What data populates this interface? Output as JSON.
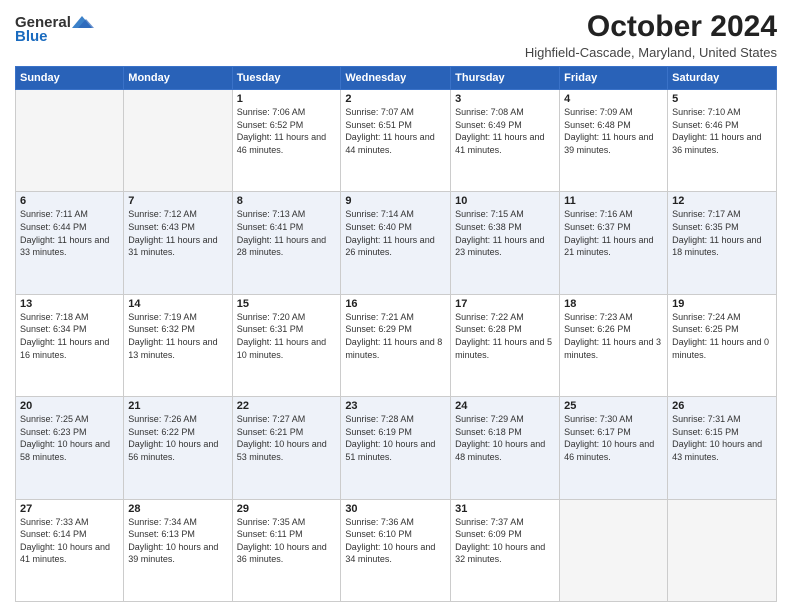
{
  "header": {
    "logo_general": "General",
    "logo_blue": "Blue",
    "month_title": "October 2024",
    "location": "Highfield-Cascade, Maryland, United States"
  },
  "days_of_week": [
    "Sunday",
    "Monday",
    "Tuesday",
    "Wednesday",
    "Thursday",
    "Friday",
    "Saturday"
  ],
  "weeks": [
    [
      {
        "day": "",
        "sunrise": "",
        "sunset": "",
        "daylight": ""
      },
      {
        "day": "",
        "sunrise": "",
        "sunset": "",
        "daylight": ""
      },
      {
        "day": "1",
        "sunrise": "Sunrise: 7:06 AM",
        "sunset": "Sunset: 6:52 PM",
        "daylight": "Daylight: 11 hours and 46 minutes."
      },
      {
        "day": "2",
        "sunrise": "Sunrise: 7:07 AM",
        "sunset": "Sunset: 6:51 PM",
        "daylight": "Daylight: 11 hours and 44 minutes."
      },
      {
        "day": "3",
        "sunrise": "Sunrise: 7:08 AM",
        "sunset": "Sunset: 6:49 PM",
        "daylight": "Daylight: 11 hours and 41 minutes."
      },
      {
        "day": "4",
        "sunrise": "Sunrise: 7:09 AM",
        "sunset": "Sunset: 6:48 PM",
        "daylight": "Daylight: 11 hours and 39 minutes."
      },
      {
        "day": "5",
        "sunrise": "Sunrise: 7:10 AM",
        "sunset": "Sunset: 6:46 PM",
        "daylight": "Daylight: 11 hours and 36 minutes."
      }
    ],
    [
      {
        "day": "6",
        "sunrise": "Sunrise: 7:11 AM",
        "sunset": "Sunset: 6:44 PM",
        "daylight": "Daylight: 11 hours and 33 minutes."
      },
      {
        "day": "7",
        "sunrise": "Sunrise: 7:12 AM",
        "sunset": "Sunset: 6:43 PM",
        "daylight": "Daylight: 11 hours and 31 minutes."
      },
      {
        "day": "8",
        "sunrise": "Sunrise: 7:13 AM",
        "sunset": "Sunset: 6:41 PM",
        "daylight": "Daylight: 11 hours and 28 minutes."
      },
      {
        "day": "9",
        "sunrise": "Sunrise: 7:14 AM",
        "sunset": "Sunset: 6:40 PM",
        "daylight": "Daylight: 11 hours and 26 minutes."
      },
      {
        "day": "10",
        "sunrise": "Sunrise: 7:15 AM",
        "sunset": "Sunset: 6:38 PM",
        "daylight": "Daylight: 11 hours and 23 minutes."
      },
      {
        "day": "11",
        "sunrise": "Sunrise: 7:16 AM",
        "sunset": "Sunset: 6:37 PM",
        "daylight": "Daylight: 11 hours and 21 minutes."
      },
      {
        "day": "12",
        "sunrise": "Sunrise: 7:17 AM",
        "sunset": "Sunset: 6:35 PM",
        "daylight": "Daylight: 11 hours and 18 minutes."
      }
    ],
    [
      {
        "day": "13",
        "sunrise": "Sunrise: 7:18 AM",
        "sunset": "Sunset: 6:34 PM",
        "daylight": "Daylight: 11 hours and 16 minutes."
      },
      {
        "day": "14",
        "sunrise": "Sunrise: 7:19 AM",
        "sunset": "Sunset: 6:32 PM",
        "daylight": "Daylight: 11 hours and 13 minutes."
      },
      {
        "day": "15",
        "sunrise": "Sunrise: 7:20 AM",
        "sunset": "Sunset: 6:31 PM",
        "daylight": "Daylight: 11 hours and 10 minutes."
      },
      {
        "day": "16",
        "sunrise": "Sunrise: 7:21 AM",
        "sunset": "Sunset: 6:29 PM",
        "daylight": "Daylight: 11 hours and 8 minutes."
      },
      {
        "day": "17",
        "sunrise": "Sunrise: 7:22 AM",
        "sunset": "Sunset: 6:28 PM",
        "daylight": "Daylight: 11 hours and 5 minutes."
      },
      {
        "day": "18",
        "sunrise": "Sunrise: 7:23 AM",
        "sunset": "Sunset: 6:26 PM",
        "daylight": "Daylight: 11 hours and 3 minutes."
      },
      {
        "day": "19",
        "sunrise": "Sunrise: 7:24 AM",
        "sunset": "Sunset: 6:25 PM",
        "daylight": "Daylight: 11 hours and 0 minutes."
      }
    ],
    [
      {
        "day": "20",
        "sunrise": "Sunrise: 7:25 AM",
        "sunset": "Sunset: 6:23 PM",
        "daylight": "Daylight: 10 hours and 58 minutes."
      },
      {
        "day": "21",
        "sunrise": "Sunrise: 7:26 AM",
        "sunset": "Sunset: 6:22 PM",
        "daylight": "Daylight: 10 hours and 56 minutes."
      },
      {
        "day": "22",
        "sunrise": "Sunrise: 7:27 AM",
        "sunset": "Sunset: 6:21 PM",
        "daylight": "Daylight: 10 hours and 53 minutes."
      },
      {
        "day": "23",
        "sunrise": "Sunrise: 7:28 AM",
        "sunset": "Sunset: 6:19 PM",
        "daylight": "Daylight: 10 hours and 51 minutes."
      },
      {
        "day": "24",
        "sunrise": "Sunrise: 7:29 AM",
        "sunset": "Sunset: 6:18 PM",
        "daylight": "Daylight: 10 hours and 48 minutes."
      },
      {
        "day": "25",
        "sunrise": "Sunrise: 7:30 AM",
        "sunset": "Sunset: 6:17 PM",
        "daylight": "Daylight: 10 hours and 46 minutes."
      },
      {
        "day": "26",
        "sunrise": "Sunrise: 7:31 AM",
        "sunset": "Sunset: 6:15 PM",
        "daylight": "Daylight: 10 hours and 43 minutes."
      }
    ],
    [
      {
        "day": "27",
        "sunrise": "Sunrise: 7:33 AM",
        "sunset": "Sunset: 6:14 PM",
        "daylight": "Daylight: 10 hours and 41 minutes."
      },
      {
        "day": "28",
        "sunrise": "Sunrise: 7:34 AM",
        "sunset": "Sunset: 6:13 PM",
        "daylight": "Daylight: 10 hours and 39 minutes."
      },
      {
        "day": "29",
        "sunrise": "Sunrise: 7:35 AM",
        "sunset": "Sunset: 6:11 PM",
        "daylight": "Daylight: 10 hours and 36 minutes."
      },
      {
        "day": "30",
        "sunrise": "Sunrise: 7:36 AM",
        "sunset": "Sunset: 6:10 PM",
        "daylight": "Daylight: 10 hours and 34 minutes."
      },
      {
        "day": "31",
        "sunrise": "Sunrise: 7:37 AM",
        "sunset": "Sunset: 6:09 PM",
        "daylight": "Daylight: 10 hours and 32 minutes."
      },
      {
        "day": "",
        "sunrise": "",
        "sunset": "",
        "daylight": ""
      },
      {
        "day": "",
        "sunrise": "",
        "sunset": "",
        "daylight": ""
      }
    ]
  ]
}
